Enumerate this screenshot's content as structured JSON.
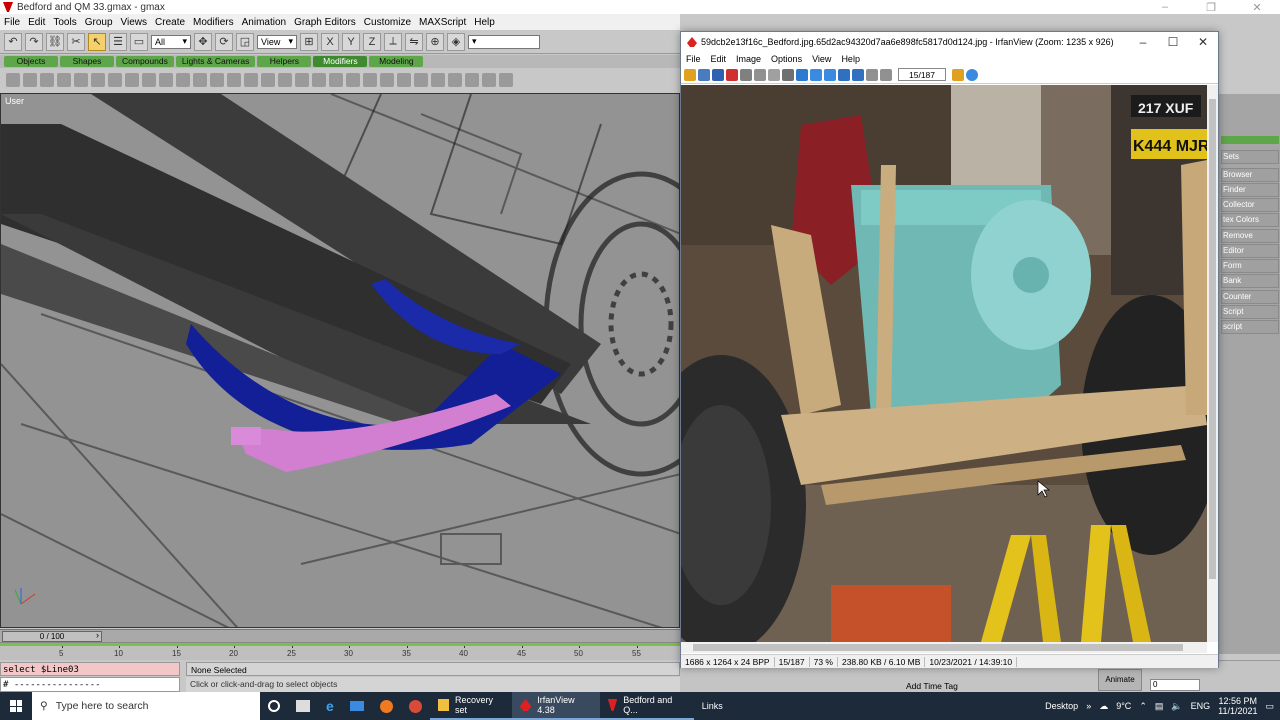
{
  "gmax": {
    "title": "Bedford and QM 33.gmax - gmax",
    "menu": [
      "File",
      "Edit",
      "Tools",
      "Group",
      "Views",
      "Create",
      "Modifiers",
      "Animation",
      "Graph Editors",
      "Customize",
      "MAXScript",
      "Help"
    ],
    "selection_filter": "All",
    "ref_coord": "View",
    "tabs": [
      "Objects",
      "Shapes",
      "Compounds",
      "Lights & Cameras",
      "Helpers",
      "Modifiers",
      "Modeling"
    ],
    "selected_tab": "Modifiers",
    "viewport_label": "User",
    "time_slider": "0 / 100",
    "track_labels": [
      "5",
      "10",
      "15",
      "20",
      "25",
      "30",
      "35",
      "40",
      "45",
      "50",
      "55"
    ],
    "listener_input": "select $Line03",
    "listener_output": "# ----------------",
    "status_selection": "None Selected",
    "status_prompt": "Click or click-and-drag to select objects",
    "add_time_tag": "Add Time Tag",
    "animate_label": "Animate",
    "frame_value": "0",
    "command_panel_items": [
      "Sets",
      "Browser",
      "Finder",
      "Collector",
      "tex Colors",
      "Remove",
      "Editor",
      "Form",
      "Bank",
      "Counter",
      "Script",
      "script"
    ],
    "colors": {
      "accent_green": "#5ea64a",
      "track_green": "#7bc04f",
      "listener_pink": "#f3c7c7"
    }
  },
  "irfanview": {
    "title": "59dcb2e13f16c_Bedford.jpg.65d2ac94320d7aa6e898fc5817d0d124.jpg - IrfanView (Zoom: 1235 x 926)",
    "menu": [
      "File",
      "Edit",
      "Image",
      "Options",
      "View",
      "Help"
    ],
    "page_counter": "15/187",
    "status": [
      "1686 x 1264 x 24 BPP",
      "15/187",
      "73 %",
      "238.80 KB / 6.10 MB",
      "10/23/2021 / 14:39:10"
    ],
    "plate1": "217 XUF",
    "plate2": "K444 MJR"
  },
  "taskbar": {
    "search_placeholder": "Type here to search",
    "apps": [
      {
        "label": "Recovery set",
        "icon": "folder-icon"
      },
      {
        "label": "IrfanView 4.38",
        "icon": "irfanview-icon"
      },
      {
        "label": "Bedford and Q...",
        "icon": "gmax-icon"
      },
      {
        "label": "Links",
        "icon": ""
      }
    ],
    "desktop_label": "Desktop",
    "weather": "9°C",
    "language": "ENG",
    "time": "12:56 PM",
    "date": "11/1/2021"
  }
}
